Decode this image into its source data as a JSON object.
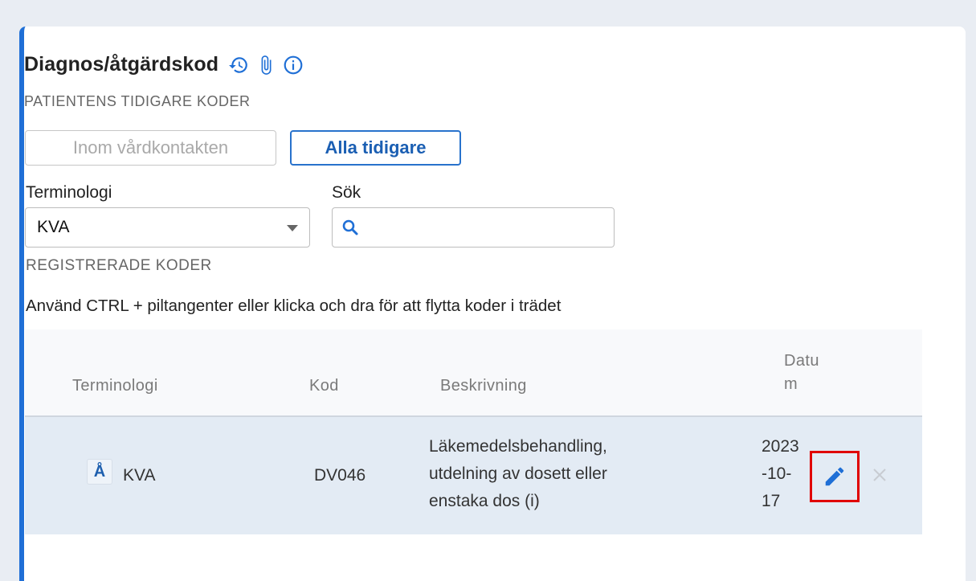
{
  "panel": {
    "title": "Diagnos/åtgärdskod",
    "subtitle": "PATIENTENS TIDIGARE KODER",
    "icons": [
      "history-icon",
      "paperclip-icon",
      "info-icon"
    ]
  },
  "filters": {
    "inom_label": "Inom vårdkontakten",
    "alla_label": "Alla tidigare",
    "terminologi_label": "Terminologi",
    "terminologi_value": "KVA",
    "sok_label": "Sök",
    "sok_value": ""
  },
  "registered": {
    "heading": "REGISTRERADE KODER",
    "hint": "Använd CTRL + piltangenter eller klicka och dra för att flytta koder i trädet",
    "columns": {
      "terminologi": "Terminologi",
      "kod": "Kod",
      "beskrivning": "Beskrivning",
      "datum_line1": "Datu",
      "datum_line2": "m"
    },
    "rows": [
      {
        "badge": "Å",
        "terminologi": "KVA",
        "kod": "DV046",
        "beskrivning_line1": "Läkemedelsbehandling,",
        "beskrivning_line2": "utdelning av dosett eller",
        "beskrivning_line3": "enstaka dos (i)",
        "datum_line1": "2023",
        "datum_line2": "-10-",
        "datum_line3": "17"
      }
    ]
  },
  "colors": {
    "accent": "#1f6fd6",
    "highlight": "#e00000",
    "row_bg": "#e3ebf4"
  }
}
